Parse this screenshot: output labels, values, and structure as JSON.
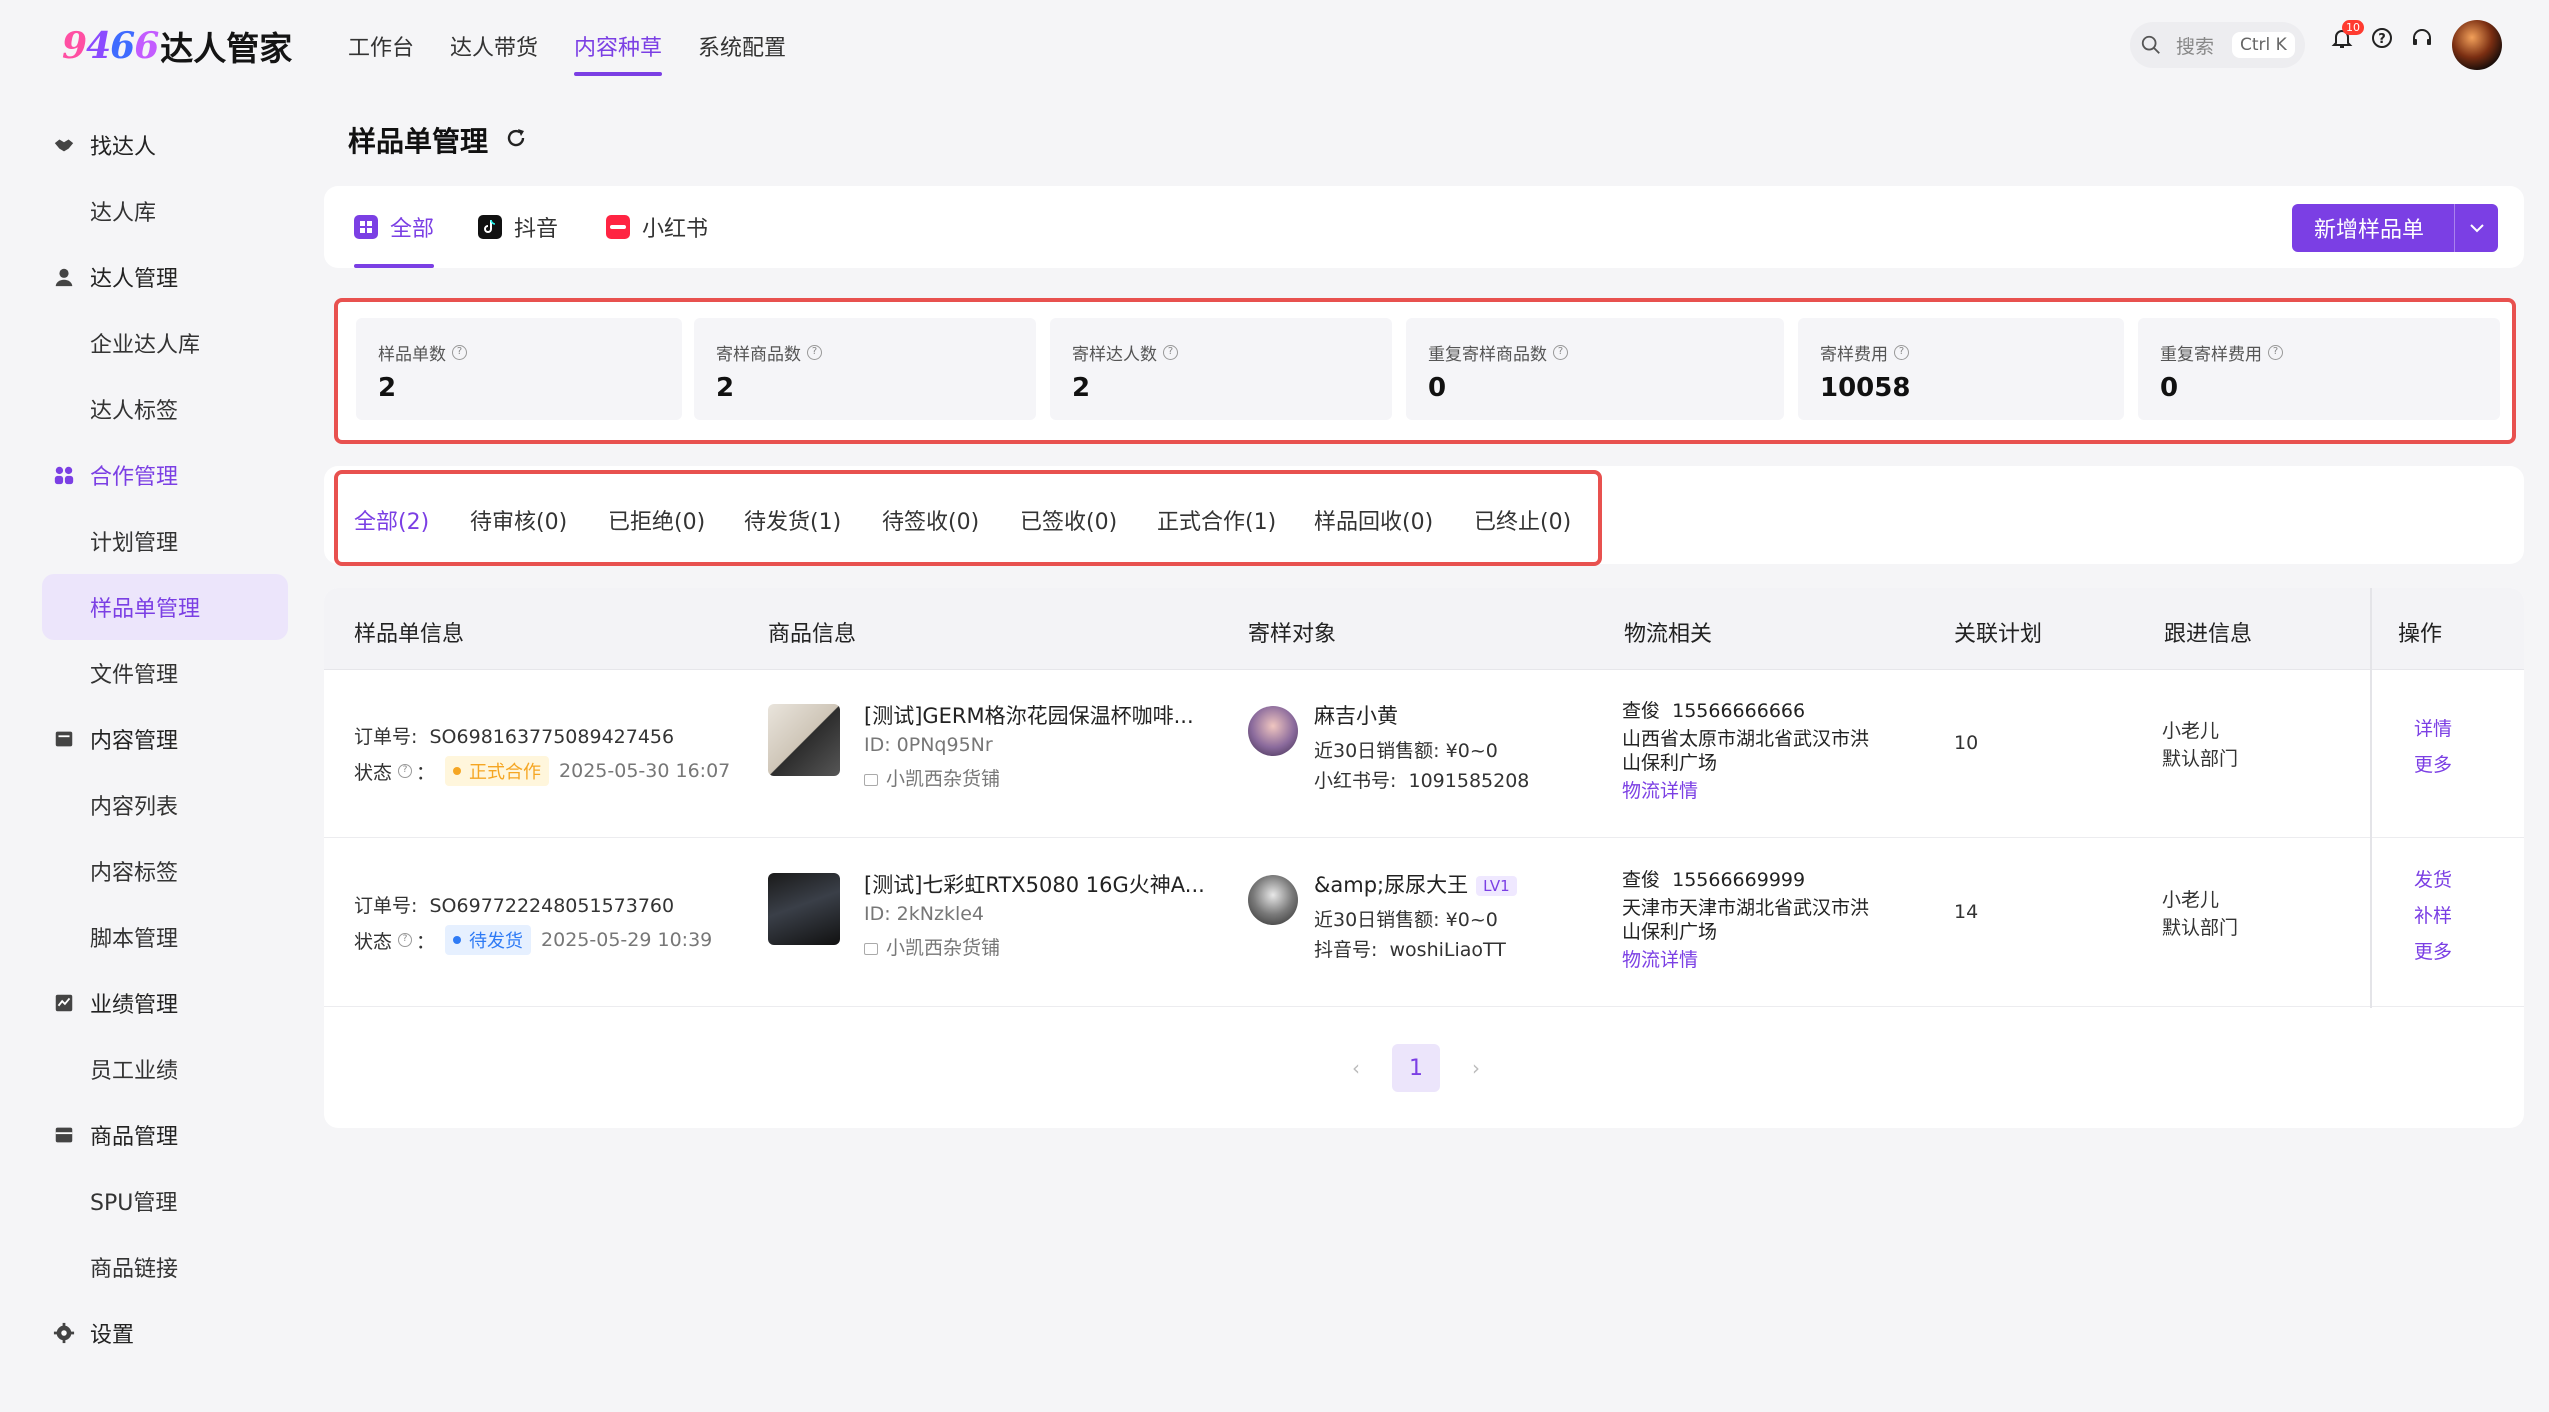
{
  "brand": {
    "logo_digits": [
      "9",
      "4",
      "6",
      "6"
    ],
    "logo_text": "达人管家",
    "colors": {
      "accent": "#7b3fe4",
      "highlight": "#e8514f"
    }
  },
  "topnav": [
    {
      "label": "工作台",
      "active": false
    },
    {
      "label": "达人带货",
      "active": false
    },
    {
      "label": "内容种草",
      "active": true
    },
    {
      "label": "系统配置",
      "active": false
    }
  ],
  "search": {
    "label": "搜索",
    "shortcut": "Ctrl K"
  },
  "notifications": {
    "count": "10"
  },
  "sidebar": {
    "groups": [
      {
        "label": "找达人",
        "icon": "handshake-icon",
        "items": [
          "达人库"
        ]
      },
      {
        "label": "达人管理",
        "icon": "user-icon",
        "items": [
          "企业达人库",
          "达人标签"
        ]
      },
      {
        "label": "合作管理",
        "icon": "users-icon",
        "items": [
          "计划管理",
          "样品单管理",
          "文件管理"
        ]
      },
      {
        "label": "内容管理",
        "icon": "folder-icon",
        "items": [
          "内容列表",
          "内容标签",
          "脚本管理"
        ]
      },
      {
        "label": "业绩管理",
        "icon": "chart-icon",
        "items": [
          "员工业绩"
        ]
      },
      {
        "label": "商品管理",
        "icon": "box-icon",
        "items": [
          "SPU管理",
          "商品链接"
        ]
      },
      {
        "label": "设置",
        "icon": "gear-icon",
        "items": []
      }
    ],
    "active_item": "样品单管理"
  },
  "page": {
    "title": "样品单管理"
  },
  "platform_tabs": [
    {
      "label": "全部",
      "active": true
    },
    {
      "label": "抖音",
      "active": false
    },
    {
      "label": "小红书",
      "active": false
    }
  ],
  "add_button": {
    "label": "新增样品单"
  },
  "stats": [
    {
      "label": "样品单数",
      "value": "2"
    },
    {
      "label": "寄样商品数",
      "value": "2"
    },
    {
      "label": "寄样达人数",
      "value": "2"
    },
    {
      "label": "重复寄样商品数",
      "value": "0"
    },
    {
      "label": "寄样费用",
      "value": "10058"
    },
    {
      "label": "重复寄样费用",
      "value": "0"
    }
  ],
  "status_tabs": [
    {
      "label": "全部(2)",
      "active": true
    },
    {
      "label": "待审核(0)"
    },
    {
      "label": "已拒绝(0)"
    },
    {
      "label": "待发货(1)"
    },
    {
      "label": "待签收(0)"
    },
    {
      "label": "已签收(0)"
    },
    {
      "label": "正式合作(1)"
    },
    {
      "label": "样品回收(0)"
    },
    {
      "label": "已终止(0)"
    }
  ],
  "table": {
    "headers": [
      "样品单信息",
      "商品信息",
      "寄样对象",
      "物流相关",
      "关联计划",
      "跟进信息",
      "操作"
    ],
    "labels": {
      "order_no": "订单号:",
      "status": "状态",
      "sales30": "近30日销售额:",
      "logistics_detail": "物流详情"
    },
    "rows": [
      {
        "order_no": "SO698163775089427456",
        "status": "正式合作",
        "status_color": "yellow",
        "time": "2025-05-30 16:07",
        "product_name": "[测试]GERM格沵花园保温杯咖啡...",
        "product_id": "ID: 0PNq95Nr",
        "shop": "小凯西杂货铺",
        "influencer": "麻吉小黄",
        "level": "",
        "sales30": "¥0~0",
        "account_label": "小红书号:",
        "account": "1091585208",
        "receiver": "查俊",
        "phone": "15566666666",
        "address": [
          "山西省太原市湖北省武汉市洪",
          "山保利广场"
        ],
        "plan": "10",
        "follower": "小老儿",
        "dept": "默认部门",
        "ops": [
          "详情",
          "更多"
        ]
      },
      {
        "order_no": "SO697722248051573760",
        "status": "待发货",
        "status_color": "blue",
        "time": "2025-05-29 10:39",
        "product_name": "[测试]七彩虹RTX5080 16G火神A...",
        "product_id": "ID: 2kNzkle4",
        "shop": "小凯西杂货铺",
        "influencer": "&amp;尿尿大王",
        "level": "LV1",
        "sales30": "¥0~0",
        "account_label": "抖音号:",
        "account": "woshiLiaoTT",
        "receiver": "查俊",
        "phone": "15566669999",
        "address": [
          "天津市天津市湖北省武汉市洪",
          "山保利广场"
        ],
        "plan": "14",
        "follower": "小老儿",
        "dept": "默认部门",
        "ops": [
          "发货",
          "补样",
          "更多"
        ]
      }
    ]
  },
  "pagination": {
    "current": "1"
  }
}
